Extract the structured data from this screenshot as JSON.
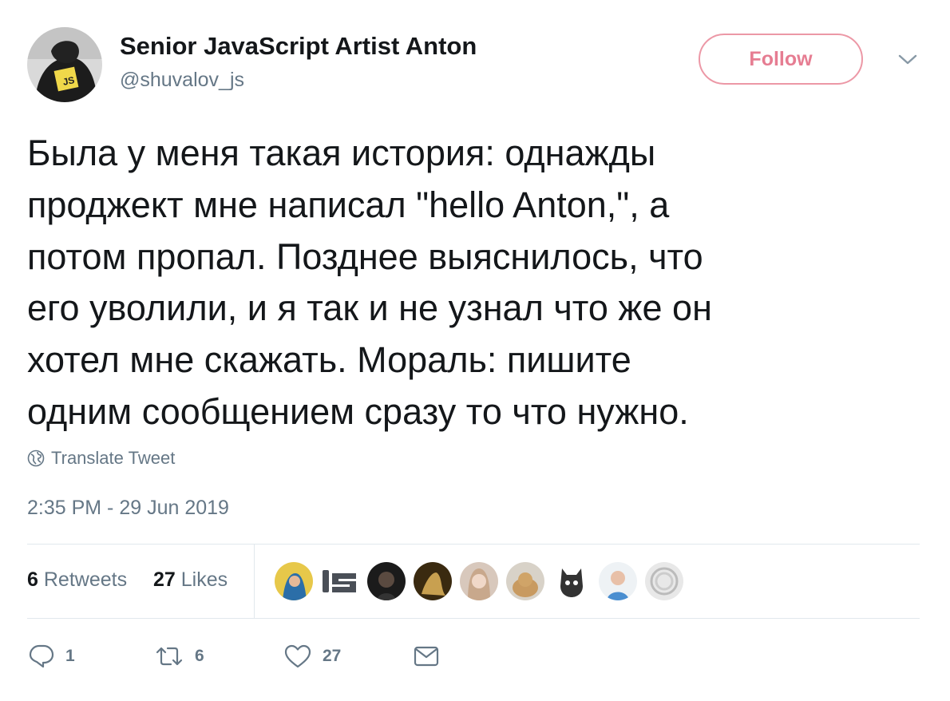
{
  "tweet": {
    "display_name": "Senior JavaScript Artist Anton",
    "handle": "@shuvalov_js",
    "follow_label": "Follow",
    "text_lines": [
      "Была у меня такая история: однажды",
      "проджект мне написал \"hello Anton,\", а",
      "потом пропал. Позднее выяснилось, что",
      "его уволили, и я так и не узнал что же он",
      "хотел мне скажать. Мораль: пишите",
      "одним сообщением сразу то что нужно."
    ],
    "translate_label": "Translate Tweet",
    "timestamp": "2:35 PM - 29 Jun 2019"
  },
  "stats": {
    "retweets_count": "6",
    "retweets_label": "Retweets",
    "likes_count": "27",
    "likes_label": "Likes"
  },
  "actions": {
    "reply_count": "1",
    "retweet_count": "6",
    "like_count": "27"
  },
  "colors": {
    "text": "#14171a",
    "muted": "#657786",
    "follow_border": "#ec98a6",
    "follow_text": "#e67d92",
    "divider": "#e1e8ed"
  }
}
